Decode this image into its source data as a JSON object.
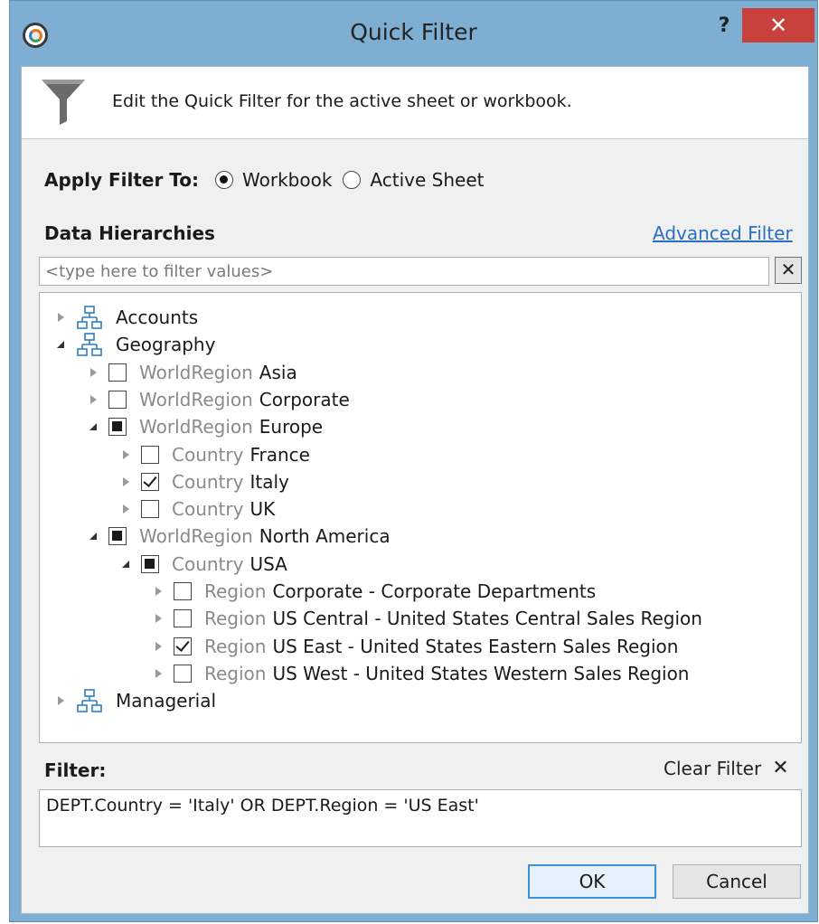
{
  "window": {
    "title": "Quick Filter",
    "help_label": "?",
    "close_label": "✕"
  },
  "header": {
    "text": "Edit the Quick Filter for the active sheet or workbook."
  },
  "apply": {
    "label": "Apply Filter To:",
    "options": [
      {
        "label": "Workbook",
        "selected": true
      },
      {
        "label": "Active Sheet",
        "selected": false
      }
    ]
  },
  "hierarchies": {
    "label": "Data Hierarchies",
    "advanced_link": "Advanced Filter",
    "filter_placeholder": "<type here to filter values>",
    "filter_value": "",
    "clear_input_label": "✕",
    "tree": [
      {
        "depth": 0,
        "expanded": false,
        "type": "hierarchy",
        "value": "Accounts"
      },
      {
        "depth": 0,
        "expanded": true,
        "type": "hierarchy",
        "value": "Geography"
      },
      {
        "depth": 1,
        "expanded": false,
        "type": "member",
        "state": "unchecked",
        "level": "WorldRegion",
        "value": "Asia"
      },
      {
        "depth": 1,
        "expanded": false,
        "type": "member",
        "state": "unchecked",
        "level": "WorldRegion",
        "value": "Corporate"
      },
      {
        "depth": 1,
        "expanded": true,
        "type": "member",
        "state": "partial",
        "level": "WorldRegion",
        "value": "Europe"
      },
      {
        "depth": 2,
        "expanded": false,
        "type": "member",
        "state": "unchecked",
        "level": "Country",
        "value": "France"
      },
      {
        "depth": 2,
        "expanded": false,
        "type": "member",
        "state": "checked",
        "level": "Country",
        "value": "Italy"
      },
      {
        "depth": 2,
        "expanded": false,
        "type": "member",
        "state": "unchecked",
        "level": "Country",
        "value": "UK"
      },
      {
        "depth": 1,
        "expanded": true,
        "type": "member",
        "state": "partial",
        "level": "WorldRegion",
        "value": "North America"
      },
      {
        "depth": 2,
        "expanded": true,
        "type": "member",
        "state": "partial",
        "level": "Country",
        "value": "USA"
      },
      {
        "depth": 3,
        "expanded": false,
        "type": "member",
        "state": "unchecked",
        "level": "Region",
        "value": "Corporate - Corporate Departments"
      },
      {
        "depth": 3,
        "expanded": false,
        "type": "member",
        "state": "unchecked",
        "level": "Region",
        "value": "US Central - United States Central Sales Region"
      },
      {
        "depth": 3,
        "expanded": false,
        "type": "member",
        "state": "checked",
        "level": "Region",
        "value": "US East - United States Eastern Sales Region"
      },
      {
        "depth": 3,
        "expanded": false,
        "type": "member",
        "state": "unchecked",
        "level": "Region",
        "value": "US West - United States Western Sales Region"
      },
      {
        "depth": 0,
        "expanded": false,
        "type": "hierarchy",
        "value": "Managerial"
      }
    ]
  },
  "filter": {
    "label": "Filter:",
    "clear_label": "Clear Filter",
    "clear_icon": "✕",
    "expression": "DEPT.Country = 'Italy' OR DEPT.Region = 'US East'"
  },
  "buttons": {
    "ok": "OK",
    "cancel": "Cancel"
  },
  "colors": {
    "titlebar": "#7eaed2",
    "close": "#c9413c",
    "link": "#2a6fc6",
    "level_text": "#8a8a8a"
  }
}
